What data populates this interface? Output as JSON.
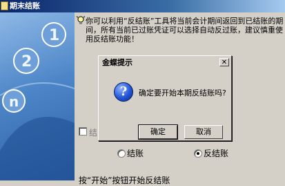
{
  "window": {
    "title": "期末结账"
  },
  "hint": {
    "text": "你可以利用“反结账”工具将当前会计期间返回到已结账的期间，所有当前已过账凭证可以选择自动反过账，建议慎重使用反结账功能！"
  },
  "checkbox": {
    "label": "结账"
  },
  "mode": {
    "options": [
      "结账",
      "反结账"
    ],
    "selected": "反结账"
  },
  "bottom": {
    "text": "按“开始”按钮开始反结账"
  },
  "dialog": {
    "title": "金蝶提示",
    "message": "确定要开始本期反结账吗?",
    "ok_label": "确定",
    "cancel_label": "取消"
  },
  "colors": {
    "titlebar": "#0a246a",
    "panel": "#4d86c8",
    "face": "#d4d0c8"
  },
  "icons": {
    "app": "app-icon",
    "hint": "bulb-icon",
    "dialog": "question-icon",
    "close": "close-icon"
  }
}
